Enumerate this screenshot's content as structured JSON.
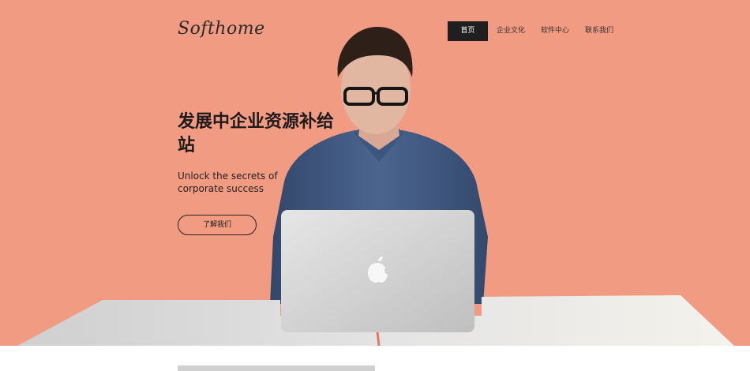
{
  "header": {
    "logo": "Softhome",
    "nav": [
      {
        "label": "首页",
        "active": true
      },
      {
        "label": "企业文化",
        "active": false
      },
      {
        "label": "软件中心",
        "active": false
      },
      {
        "label": "联系我们",
        "active": false
      }
    ]
  },
  "hero": {
    "headline": "发展中企业资源补给站",
    "subheadline": "Unlock the secrets of corporate success",
    "cta_label": "了解我们",
    "background_color": "#f09b82"
  }
}
